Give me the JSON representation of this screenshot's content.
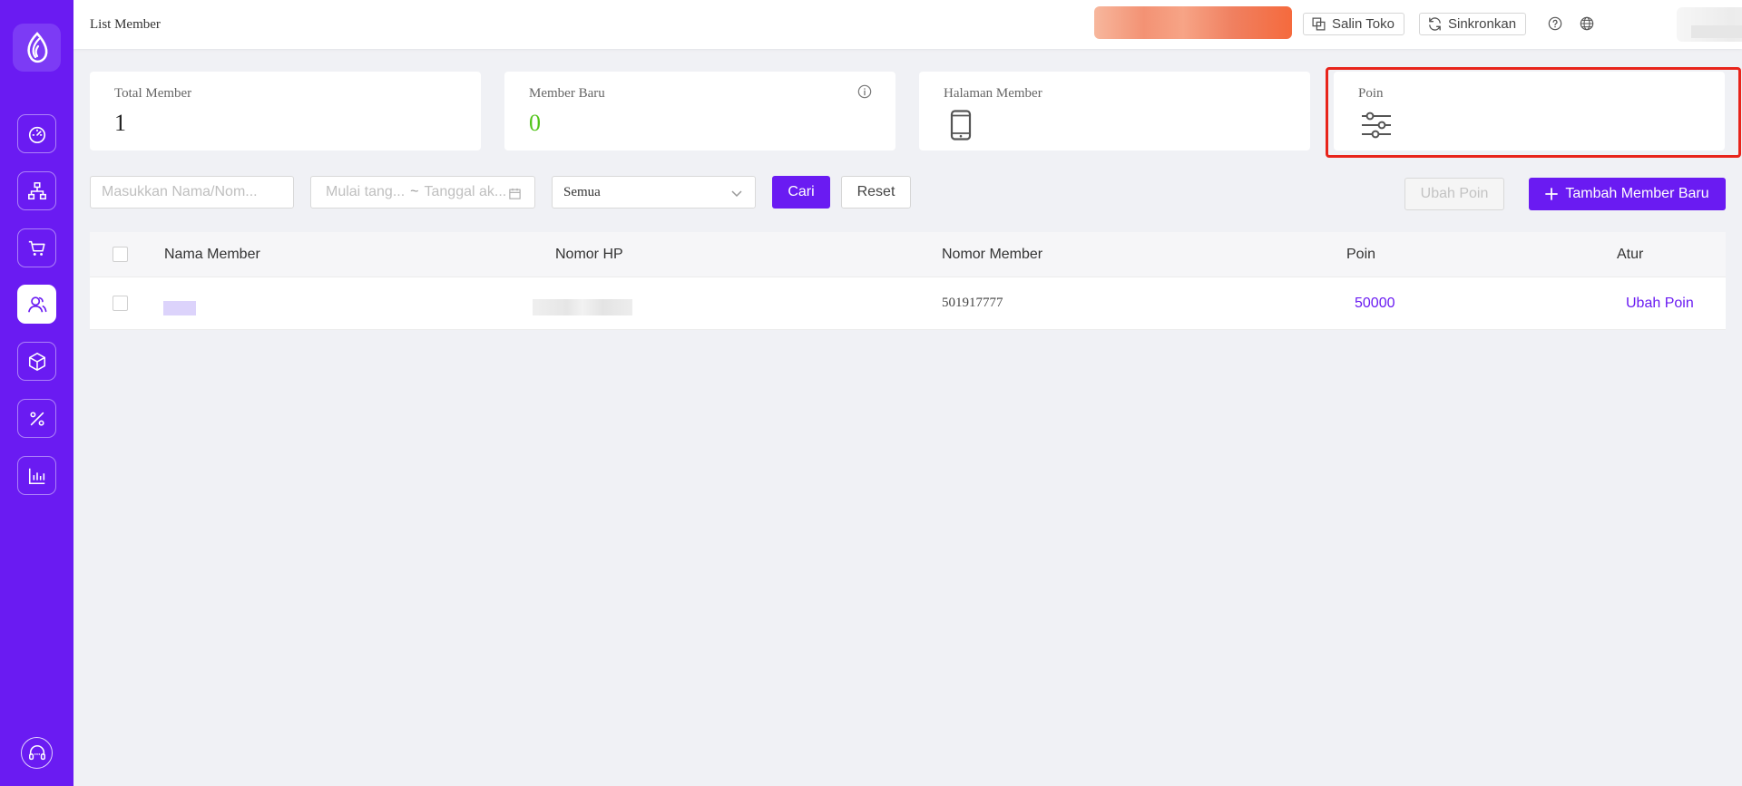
{
  "header": {
    "title": "List Member",
    "copy_store_label": "Salin Toko",
    "sync_label": "Sinkronkan"
  },
  "stats": [
    {
      "label": "Total Member",
      "value": "1"
    },
    {
      "label": "Member Baru",
      "value": "0"
    },
    {
      "label": "Halaman Member"
    },
    {
      "label": "Poin"
    }
  ],
  "filters": {
    "search_placeholder": "Masukkan Nama/Nom...",
    "date_start_placeholder": "Mulai tang...",
    "date_separator": "~",
    "date_end_placeholder": "Tanggal ak...",
    "select_value": "Semua",
    "search_button": "Cari",
    "reset_button": "Reset"
  },
  "actions": {
    "change_points": "Ubah Poin",
    "add_member": "Tambah Member Baru"
  },
  "table": {
    "columns": [
      "Nama Member",
      "Nomor HP",
      "Nomor Member",
      "Poin",
      "Atur"
    ],
    "rows": [
      {
        "member_number": "501917777",
        "points": "50000",
        "action": "Ubah Poin"
      }
    ]
  },
  "colors": {
    "brand": "#6a1bf2",
    "new_member_value": "#52c41a",
    "highlight": "#e8241b"
  },
  "icons": {
    "sidebar": [
      "dashboard-icon",
      "organization-icon",
      "cart-icon",
      "members-icon",
      "package-icon",
      "percent-icon",
      "report-icon"
    ],
    "support": "headset-icon"
  }
}
